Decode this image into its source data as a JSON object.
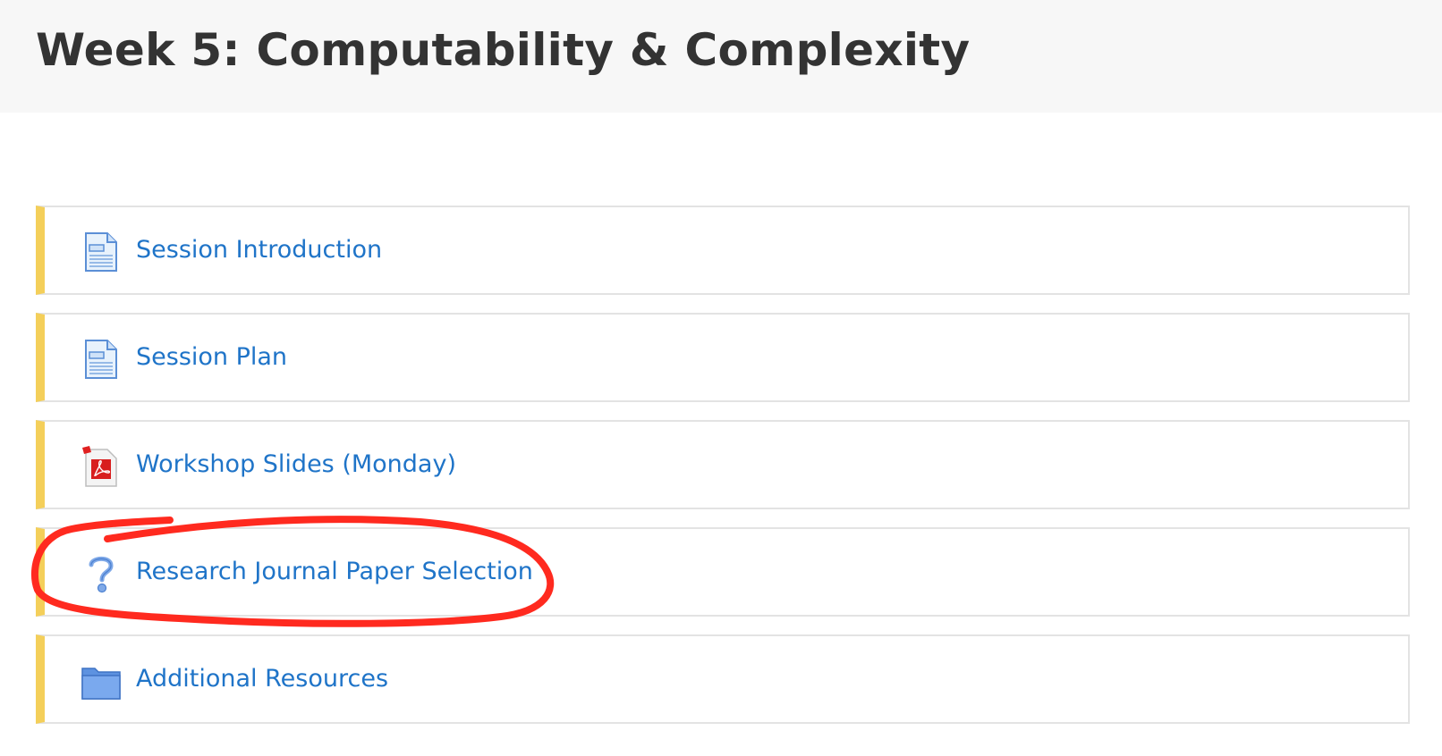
{
  "page": {
    "title": "Week 5: Computability & Complexity"
  },
  "activities": [
    {
      "label": "Session Introduction",
      "icon": "page-icon"
    },
    {
      "label": "Session Plan",
      "icon": "page-icon"
    },
    {
      "label": "Workshop Slides (Monday)",
      "icon": "pdf-icon"
    },
    {
      "label": "Research Journal Paper Selection",
      "icon": "question-icon"
    },
    {
      "label": "Additional Resources",
      "icon": "folder-icon"
    }
  ],
  "colors": {
    "accent_bar": "#f4cf5a",
    "link": "#1f74c8",
    "title": "#333333",
    "header_bg": "#f7f7f7",
    "annotation_circle": "#ff2a1f"
  },
  "annotation": {
    "type": "hand-drawn-circle",
    "target": "Research Journal Paper Selection"
  }
}
